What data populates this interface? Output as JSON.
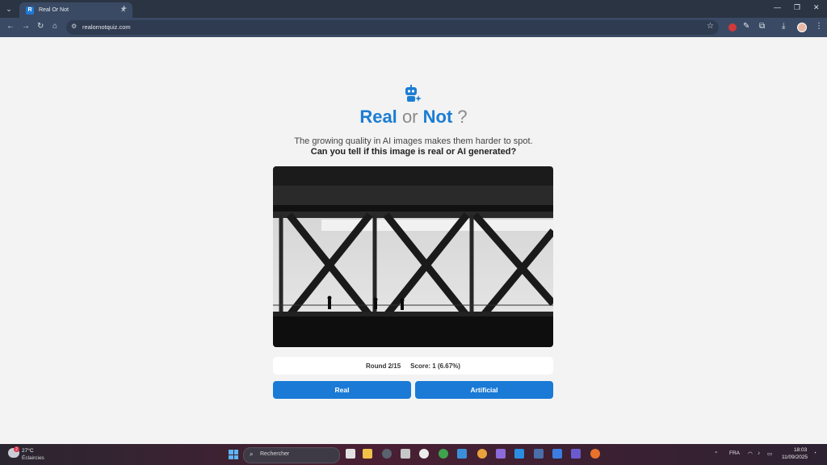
{
  "browser": {
    "tab_title": "Real Or Not",
    "tab_list_glyph": "⌄",
    "tab_close_glyph": "✕",
    "new_tab_glyph": "+",
    "url": "realornotquiz.com",
    "window_controls": {
      "minimize": "—",
      "restore": "❐",
      "close": "✕"
    }
  },
  "page": {
    "title_parts": {
      "real": "Real",
      "or": "or",
      "not": "Not",
      "question": "?"
    },
    "subtitle": "The growing quality in AI images makes them harder to spot.",
    "question": "Can you tell if this image is real or AI generated?",
    "round": "Round 2/15",
    "score": "Score: 1 (6.67%)",
    "buttons": {
      "real": "Real",
      "artificial": "Artificial"
    },
    "accent_color": "#1b7dd4",
    "image_subject": "bridge truss silhouette with walking people"
  },
  "taskbar": {
    "weather_temp": "27°C",
    "weather_desc": "Éclaircies",
    "weather_badge": "2",
    "search_placeholder": "Rechercher",
    "language": "FRA",
    "time": "18:03",
    "date": "11/09/2025"
  }
}
